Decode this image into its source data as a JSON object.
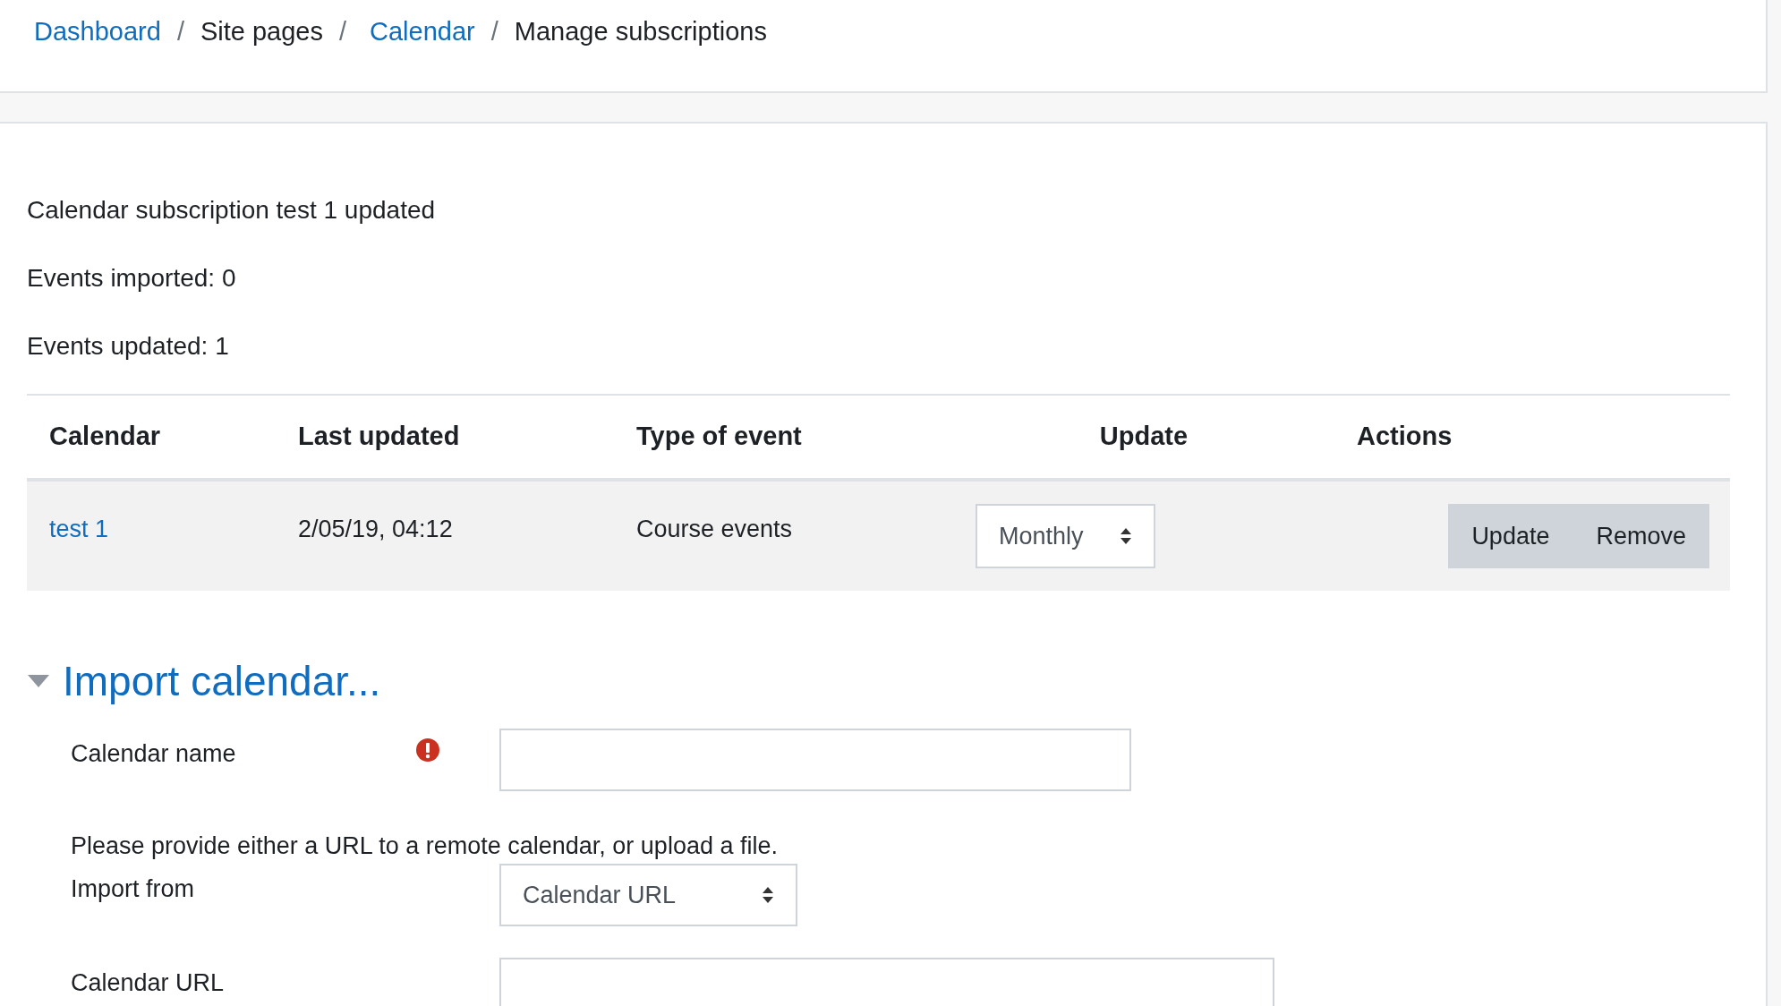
{
  "breadcrumb": [
    {
      "label": "Dashboard",
      "kind": "link"
    },
    {
      "label": "Site pages",
      "kind": "text"
    },
    {
      "label": "Calendar",
      "kind": "link"
    },
    {
      "label": "Manage subscriptions",
      "kind": "text"
    }
  ],
  "breadcrumb_separator": "/",
  "messages": [
    "Calendar subscription test 1 updated",
    "Events imported: 0",
    "Events updated: 1"
  ],
  "table": {
    "columns": [
      "Calendar",
      "Last updated",
      "Type of event",
      "Update",
      "Actions"
    ],
    "rows": [
      {
        "calendar": "test 1",
        "last_updated": "2/05/19, 04:12",
        "type": "Course events",
        "update": "Monthly",
        "actions": [
          "Update",
          "Remove"
        ]
      }
    ]
  },
  "import_section": {
    "title": "Import calendar...",
    "expanded": true,
    "fields": [
      {
        "kind": "text",
        "label": "Calendar name",
        "required": true
      },
      {
        "kind": "note",
        "text": "Please provide either a URL to a remote calendar, or upload a file."
      },
      {
        "kind": "select",
        "label": "Import from",
        "value": "Calendar URL"
      },
      {
        "kind": "text",
        "label": "Calendar URL"
      }
    ]
  }
}
